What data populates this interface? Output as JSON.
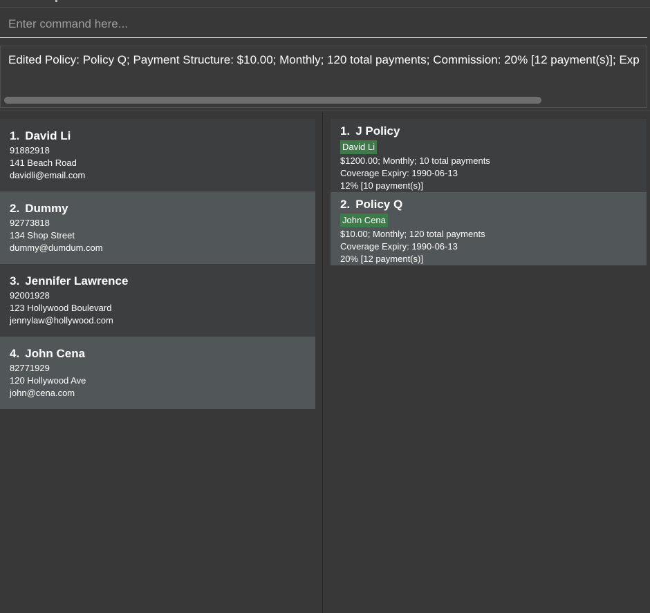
{
  "command_box": {
    "placeholder": "Enter command here..."
  },
  "result_display": {
    "text": "Edited Policy: Policy Q; Payment Structure: $10.00; Monthly; 120 total payments; Commission: 20% [12 payment(s)]; Exp"
  },
  "persons": [
    {
      "index": "1.",
      "name": "David Li",
      "phone": "91882918",
      "address": "141 Beach Road",
      "email": "davidli@email.com"
    },
    {
      "index": "2.",
      "name": "Dummy",
      "phone": "92773818",
      "address": "134 Shop Street",
      "email": "dummy@dumdum.com"
    },
    {
      "index": "3.",
      "name": "Jennifer Lawrence",
      "phone": "92001928",
      "address": "123 Hollywood Boulevard",
      "email": "jennylaw@hollywood.com"
    },
    {
      "index": "4.",
      "name": "John Cena",
      "phone": "82771929",
      "address": "120 Hollywood Ave",
      "email": "john@cena.com"
    }
  ],
  "policies": [
    {
      "index": "1.",
      "name": "J Policy",
      "client": "David Li",
      "payment": "$1200.00; Monthly; 10 total payments",
      "expiry": "Coverage Expiry: 1990-06-13",
      "commission": "12% [10 payment(s)]"
    },
    {
      "index": "2.",
      "name": "Policy Q",
      "client": "John Cena",
      "payment": "$10.00; Monthly; 120 total payments",
      "expiry": "Coverage Expiry: 1990-06-13",
      "commission": "20% [12 payment(s)]"
    }
  ],
  "colors": {
    "background": "#383838",
    "card": "#3c3e3f",
    "card_selected": "#515658",
    "tag": "#3e7b4a"
  }
}
